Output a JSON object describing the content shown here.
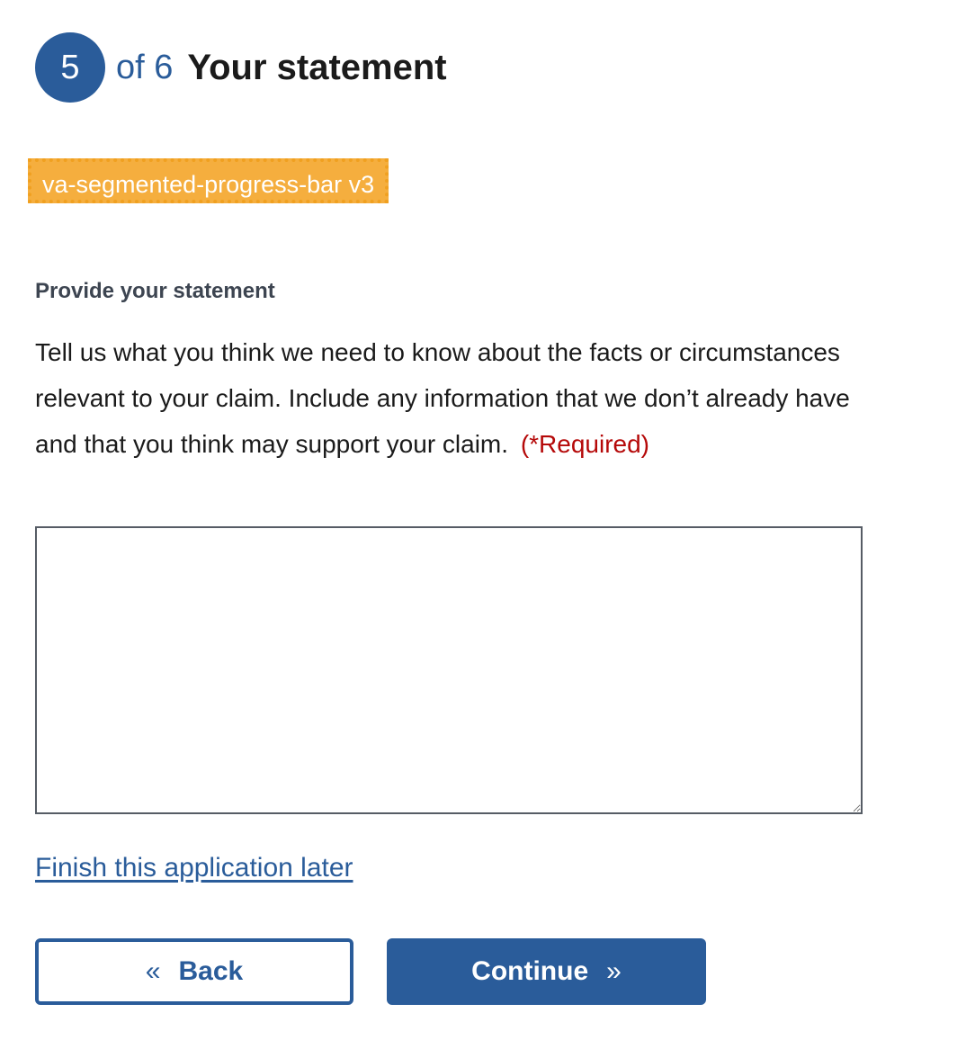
{
  "step": {
    "current": "5",
    "of_text": "of 6",
    "title": "Your statement"
  },
  "component_tag": "va-segmented-progress-bar v3",
  "field": {
    "label": "Provide your statement",
    "hint": "Tell us what you think we need to know about the facts or circumstances relevant to your claim. Include any information that we don’t already have and that you think may support your claim.",
    "required": "(*Required)",
    "value": ""
  },
  "links": {
    "finish_later": "Finish this application later"
  },
  "buttons": {
    "back_label": "Back",
    "back_icon": "«",
    "continue_label": "Continue",
    "continue_icon": "»"
  },
  "colors": {
    "primary": "#2a5c9a",
    "required": "#b50909",
    "tag_bg": "#f5ae3e"
  }
}
